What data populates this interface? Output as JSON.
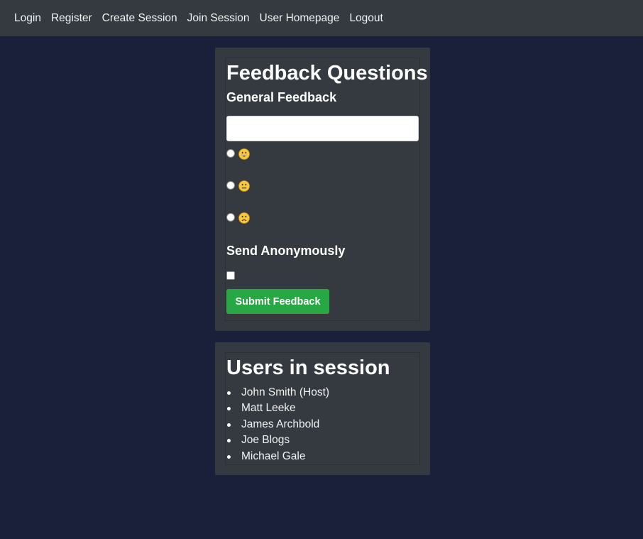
{
  "nav": {
    "items": [
      {
        "label": "Login"
      },
      {
        "label": "Register"
      },
      {
        "label": "Create Session"
      },
      {
        "label": "Join Session"
      },
      {
        "label": "User Homepage"
      },
      {
        "label": "Logout"
      }
    ]
  },
  "feedback": {
    "title": "Feedback Questions",
    "question": "General Feedback",
    "input_value": "",
    "options": [
      {
        "icon": "grinning-face-icon"
      },
      {
        "icon": "neutral-face-icon"
      },
      {
        "icon": "slightly-frowning-face-icon"
      }
    ],
    "anonymous_label": "Send Anonymously",
    "submit_label": "Submit Feedback"
  },
  "users": {
    "title": "Users in session",
    "list": [
      "John Smith (Host)",
      "Matt Leeke",
      "James Archbold",
      "Joe Blogs",
      "Michael Gale"
    ]
  },
  "colors": {
    "background": "#1a203a",
    "panel": "#343a40",
    "submit": "#28a745"
  }
}
